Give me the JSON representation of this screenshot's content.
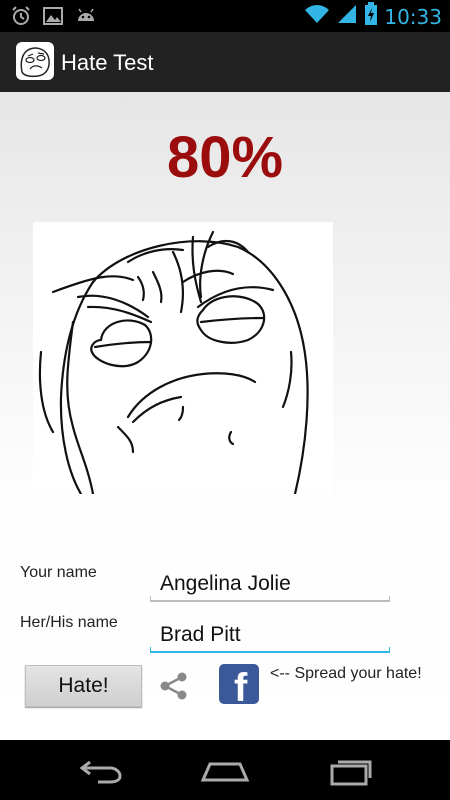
{
  "status_bar": {
    "time": "10:33",
    "icons": [
      "alarm-icon",
      "gallery-icon",
      "android-icon",
      "wifi-icon",
      "signal-icon",
      "battery-charging-icon"
    ]
  },
  "action_bar": {
    "title": "Hate Test",
    "icon": "rage-face-app-icon"
  },
  "result": {
    "percent": "80%",
    "color": "#9b0d0d",
    "image": "rage-face-illustration"
  },
  "form": {
    "your_name_label": "Your name",
    "your_name_value": "Angelina Jolie",
    "other_name_label": "Her/His name",
    "other_name_value": "Brad Pitt"
  },
  "actions": {
    "hate_button": "Hate!",
    "share_icon": "share-icon",
    "facebook_icon": "facebook-icon",
    "spread_text": "<-- Spread your hate!"
  },
  "nav_bar": {
    "back_icon": "back-icon",
    "home_icon": "home-icon",
    "recents_icon": "recent-apps-icon"
  },
  "colors": {
    "accent": "#33b5e5",
    "facebook": "#3b5998"
  }
}
